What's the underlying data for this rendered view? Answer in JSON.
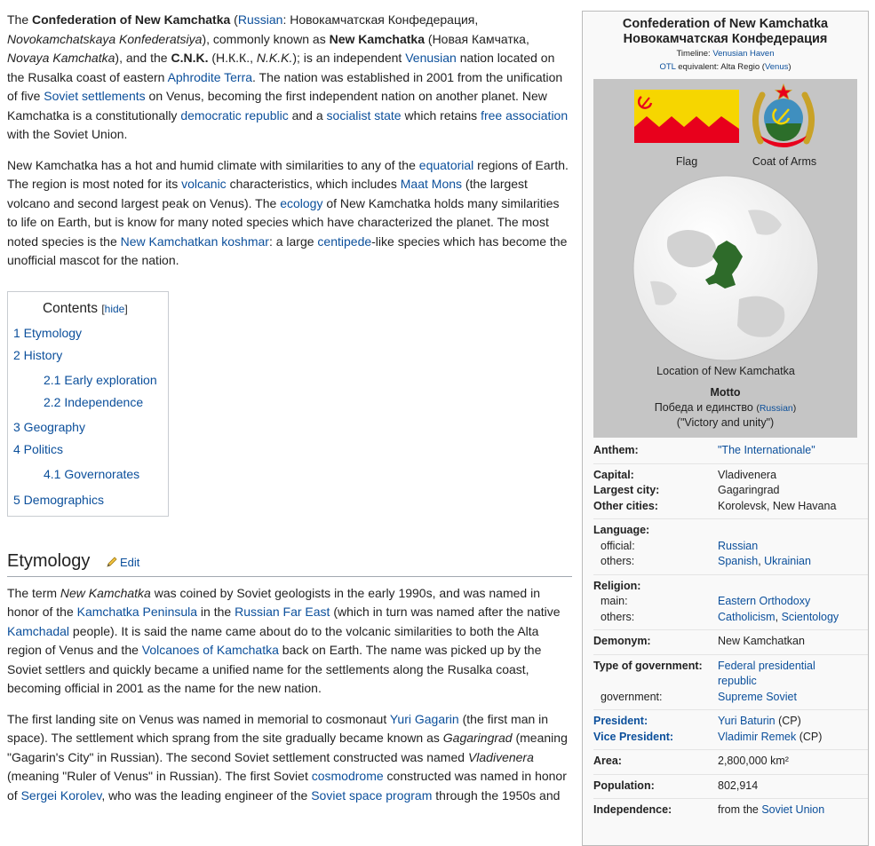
{
  "article": {
    "p1": [
      {
        "t": "The "
      },
      {
        "t": "Confederation of New Kamchatka",
        "b": 1
      },
      {
        "t": " ("
      },
      {
        "t": "Russian",
        "a": 1
      },
      {
        "t": ": Новокамчатская Конфедерация, "
      },
      {
        "t": "Novokamchatskaya Konfederatsiya",
        "i": 1
      },
      {
        "t": "), commonly known as "
      },
      {
        "t": "New Kamchatka",
        "b": 1
      },
      {
        "t": " (Новая Камчатка, "
      },
      {
        "t": "Novaya Kamchatka",
        "i": 1
      },
      {
        "t": "), and the "
      },
      {
        "t": "C.N.K.",
        "b": 1
      },
      {
        "t": " (Н.К.К., "
      },
      {
        "t": "N.K.K.",
        "i": 1
      },
      {
        "t": "); is an independent "
      },
      {
        "t": "Venusian",
        "a": 1
      },
      {
        "t": " nation located on the Rusalka coast of eastern "
      },
      {
        "t": "Aphrodite Terra",
        "a": 1
      },
      {
        "t": ". The nation was established in 2001 from the unification of five "
      },
      {
        "t": "Soviet settlements",
        "a": 1
      },
      {
        "t": " on Venus, becoming the first independent nation on another planet. New Kamchatka is a constitutionally "
      },
      {
        "t": "democratic republic",
        "a": 1
      },
      {
        "t": " and a "
      },
      {
        "t": "socialist state",
        "a": 1
      },
      {
        "t": " which retains "
      },
      {
        "t": "free association",
        "a": 1
      },
      {
        "t": " with the Soviet Union."
      }
    ],
    "p2": [
      {
        "t": "New Kamchatka has a hot and humid climate with similarities to any of the "
      },
      {
        "t": "equatorial",
        "a": 1
      },
      {
        "t": " regions of Earth. The region is most noted for its "
      },
      {
        "t": "volcanic",
        "a": 1
      },
      {
        "t": " characteristics, which includes "
      },
      {
        "t": "Maat Mons",
        "a": 1
      },
      {
        "t": " (the largest volcano and second largest peak on Venus). The "
      },
      {
        "t": "ecology",
        "a": 1
      },
      {
        "t": " of New Kamchatka holds many similarities to life on Earth, but is know for many noted species which have characterized the planet. The most noted species is the "
      },
      {
        "t": "New Kamchatkan koshmar",
        "a": 1
      },
      {
        "t": ": a large "
      },
      {
        "t": "centipede",
        "a": 1
      },
      {
        "t": "-like species which has become the unofficial mascot for the nation."
      }
    ],
    "toc": {
      "title": "Contents",
      "hide": "hide",
      "items": [
        {
          "n": "1",
          "label": "Etymology",
          "sub": 0
        },
        {
          "n": "2",
          "label": "History",
          "sub": 0
        },
        {
          "n": "2.1",
          "label": "Early exploration",
          "sub": 1
        },
        {
          "n": "2.2",
          "label": "Independence",
          "sub": 1
        },
        {
          "n": "3",
          "label": "Geography",
          "sub": 0
        },
        {
          "n": "4",
          "label": "Politics",
          "sub": 0
        },
        {
          "n": "4.1",
          "label": "Governorates",
          "sub": 1
        },
        {
          "n": "5",
          "label": "Demographics",
          "sub": 0
        }
      ]
    },
    "h_etymology": "Etymology",
    "edit": "Edit",
    "p3": [
      {
        "t": "The term "
      },
      {
        "t": "New Kamchatka",
        "i": 1
      },
      {
        "t": " was coined by Soviet geologists in the early 1990s, and was named in honor of the "
      },
      {
        "t": "Kamchatka Peninsula",
        "a": 1
      },
      {
        "t": " in the "
      },
      {
        "t": "Russian Far East",
        "a": 1
      },
      {
        "t": " (which in turn was named after the native "
      },
      {
        "t": "Kamchadal",
        "a": 1
      },
      {
        "t": " people). It is said the name came about do to the volcanic similarities to both the Alta region of Venus and the "
      },
      {
        "t": "Volcanoes of Kamchatka",
        "a": 1
      },
      {
        "t": " back on Earth. The name was picked up by the Soviet settlers and quickly became a unified name for the settlements along the Rusalka coast, becoming official in 2001 as the name for the new nation."
      }
    ],
    "p4": [
      {
        "t": "The first landing site on Venus was named in memorial to cosmonaut "
      },
      {
        "t": "Yuri Gagarin",
        "a": 1
      },
      {
        "t": " (the first man in space). The settlement which sprang from the site gradually became known as "
      },
      {
        "t": "Gagaringrad",
        "i": 1
      },
      {
        "t": " (meaning \"Gagarin's City\" in Russian). The second Soviet settlement constructed was named "
      },
      {
        "t": "Vladivenera",
        "i": 1
      },
      {
        "t": " (meaning \"Ruler of Venus\" in Russian). The first Soviet "
      },
      {
        "t": "cosmodrome",
        "a": 1
      },
      {
        "t": " constructed was named in honor of "
      },
      {
        "t": "Sergei Korolev",
        "a": 1
      },
      {
        "t": ", who was the leading engineer of the "
      },
      {
        "t": "Soviet space program",
        "a": 1
      },
      {
        "t": " through the 1950s and"
      }
    ]
  },
  "infobox": {
    "title1": "Confederation of New Kamchatka",
    "title2": "Новокамчатская Конфедерация",
    "timeline_label": "Timeline: ",
    "timeline_link": "Venusian Haven",
    "otl_link": "OTL",
    "otl_text": " equivalent: Alta Regio (",
    "otl_link2": "Venus",
    "otl_close": ")",
    "flag_caption": "Flag",
    "coa_caption": "Coat of Arms",
    "location_caption": "Location of New Kamchatka",
    "motto_label": "Motto",
    "motto_native": "Победа и единство",
    "motto_lang": "Russian",
    "motto_trans": "(\"Victory and unity\")",
    "colors": {
      "flag_yellow": "#f6d600",
      "flag_red": "#e8001c",
      "land": "#2e6b2a"
    },
    "rows": [
      {
        "label": "Anthem:",
        "val": [
          {
            "t": "\"The Internationale\"",
            "a": 1
          }
        ],
        "sep": 0
      },
      {
        "label": "Capital:",
        "val": [
          {
            "t": "Vladivenera"
          }
        ],
        "sep": 1
      },
      {
        "label": "Largest city:",
        "val": [
          {
            "t": "Gagaringrad"
          }
        ]
      },
      {
        "label": "Other cities:",
        "val": [
          {
            "t": "Korolevsk, New Havana"
          }
        ]
      },
      {
        "label": "Language:",
        "val": [],
        "sep": 1
      },
      {
        "label": "official:",
        "sub": 1,
        "val": [
          {
            "t": "Russian",
            "a": 1
          }
        ]
      },
      {
        "label": "others:",
        "sub": 1,
        "val": [
          {
            "t": "Spanish",
            "a": 1
          },
          {
            "t": ", "
          },
          {
            "t": "Ukrainian",
            "a": 1
          }
        ]
      },
      {
        "label": "Religion:",
        "val": [],
        "sep": 1
      },
      {
        "label": "main:",
        "sub": 1,
        "val": [
          {
            "t": "Eastern Orthodoxy",
            "a": 1
          }
        ]
      },
      {
        "label": "others:",
        "sub": 1,
        "val": [
          {
            "t": "Catholicism",
            "a": 1
          },
          {
            "t": ", "
          },
          {
            "t": "Scientology",
            "a": 1
          }
        ]
      },
      {
        "label": "Demonym:",
        "val": [
          {
            "t": "New Kamchatkan"
          }
        ],
        "sep": 1
      },
      {
        "label": "Type of government:",
        "val": [
          {
            "t": "Federal presidential republic",
            "a": 1
          }
        ],
        "sep": 1
      },
      {
        "label": "government:",
        "sub": 1,
        "val": [
          {
            "t": "Supreme Soviet",
            "a": 1
          }
        ]
      },
      {
        "label": "President:",
        "lblLink": 1,
        "val": [
          {
            "t": "Yuri Baturin",
            "a": 1
          },
          {
            "t": " (CP)"
          }
        ],
        "sep": 1
      },
      {
        "label": "Vice President:",
        "lblLink": 1,
        "val": [
          {
            "t": "Vladimir Remek",
            "a": 1
          },
          {
            "t": " (CP)"
          }
        ]
      },
      {
        "label": "Area:",
        "val": [
          {
            "t": "2,800,000 km²"
          }
        ],
        "sep": 1
      },
      {
        "label": "Population:",
        "val": [
          {
            "t": "802,914"
          }
        ],
        "sep": 1
      },
      {
        "label": "Independence:",
        "val": [
          {
            "t": "from the "
          },
          {
            "t": "Soviet Union",
            "a": 1
          }
        ],
        "sep": 1
      }
    ]
  }
}
